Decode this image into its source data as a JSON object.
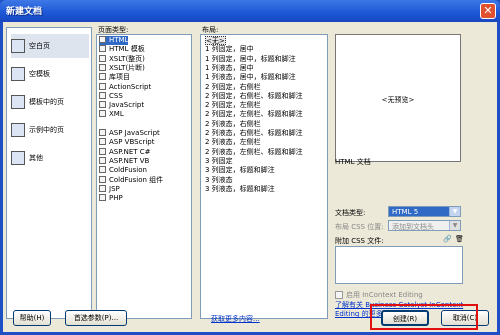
{
  "window": {
    "title": "新建文档",
    "close": "✕"
  },
  "categories": [
    {
      "label": "空白页",
      "icon": "blank-page-icon",
      "selected": true
    },
    {
      "label": "空模板",
      "icon": "blank-template-icon",
      "selected": false
    },
    {
      "label": "模板中的页",
      "icon": "template-page-icon",
      "selected": false
    },
    {
      "label": "示例中的页",
      "icon": "sample-page-icon",
      "selected": false
    },
    {
      "label": "其他",
      "icon": "other-icon",
      "selected": false
    }
  ],
  "types": {
    "header": "页面类型:",
    "items": [
      {
        "label": "HTML",
        "selected": true
      },
      {
        "label": "HTML 模板"
      },
      {
        "label": "XSLT(整页)"
      },
      {
        "label": "XSLT(片断)"
      },
      {
        "label": "库项目"
      },
      {
        "label": "ActionScript"
      },
      {
        "label": "CSS"
      },
      {
        "label": "JavaScript"
      },
      {
        "label": "XML"
      },
      {
        "label": ""
      },
      {
        "label": "ASP JavaScript"
      },
      {
        "label": "ASP VBScript"
      },
      {
        "label": "ASP.NET C#"
      },
      {
        "label": "ASP.NET VB"
      },
      {
        "label": "ColdFusion"
      },
      {
        "label": "ColdFusion 组件"
      },
      {
        "label": "JSP"
      },
      {
        "label": "PHP"
      }
    ]
  },
  "layouts": {
    "header": "布局:",
    "items": [
      {
        "label": "<无>",
        "selected": true
      },
      {
        "label": "1 列固定，居中"
      },
      {
        "label": "1 列固定，居中，标题和脚注"
      },
      {
        "label": "1 列液态，居中"
      },
      {
        "label": "1 列液态，居中，标题和脚注"
      },
      {
        "label": "2 列固定，右侧栏"
      },
      {
        "label": "2 列固定，右侧栏、标题和脚注"
      },
      {
        "label": "2 列固定，左侧栏"
      },
      {
        "label": "2 列固定，左侧栏、标题和脚注"
      },
      {
        "label": "2 列液态，右侧栏"
      },
      {
        "label": "2 列液态，右侧栏、标题和脚注"
      },
      {
        "label": "2 列液态，左侧栏"
      },
      {
        "label": "2 列液态，左侧栏、标题和脚注"
      },
      {
        "label": "3 列固定"
      },
      {
        "label": "3 列固定，标题和脚注"
      },
      {
        "label": "3 列液态"
      },
      {
        "label": "3 列液态，标题和脚注"
      }
    ]
  },
  "preview": {
    "text": "<无预览>",
    "caption": "HTML 文档"
  },
  "doctype": {
    "label": "文档类型:",
    "value": "HTML 5"
  },
  "layout_css": {
    "label": "布局 CSS 位置:",
    "value": "添加到文档头"
  },
  "attach_css": {
    "label": "附加 CSS 文件:"
  },
  "incontext": {
    "label": "启用 InContext Editing"
  },
  "business_link": {
    "line1": "了解有关 Business Catalyst InContext",
    "line2": "Editing 的更多信息"
  },
  "buttons": {
    "help": "帮助(H)",
    "prefs": "首选参数(P)...",
    "more": "获取更多内容...",
    "create": "创建(R)",
    "cancel": "取消(C)"
  }
}
